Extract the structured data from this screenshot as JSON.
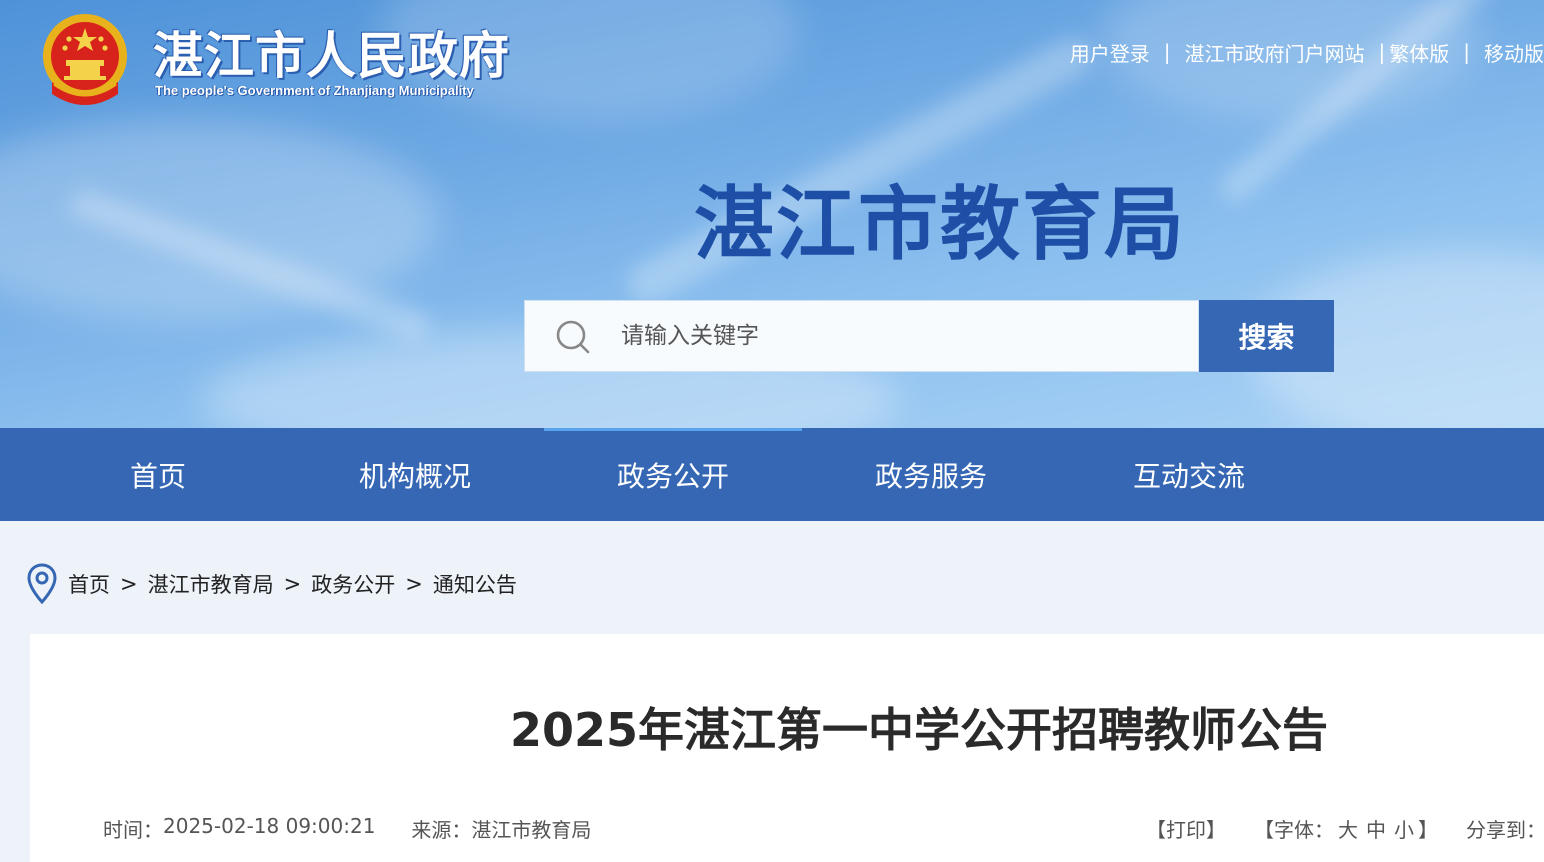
{
  "header": {
    "gov_title": "湛江市人民政府",
    "gov_subtitle": "The people's Government of Zhanjiang Municipality",
    "bureau_title": "湛江市教育局",
    "top_links": {
      "login": "用户登录",
      "portal": "湛江市政府门户网站",
      "traditional": "繁体版",
      "mobile": "移动版",
      "separator": "|"
    }
  },
  "search": {
    "placeholder": "请输入关键字",
    "button_label": "搜索"
  },
  "nav": {
    "items": [
      {
        "label": "首页"
      },
      {
        "label": "机构概况"
      },
      {
        "label": "政务公开"
      },
      {
        "label": "政务服务"
      },
      {
        "label": "互动交流"
      }
    ],
    "active": "政务公开"
  },
  "breadcrumb": {
    "items": [
      "首页",
      "湛江市教育局",
      "政务公开",
      "通知公告"
    ],
    "separator": ">"
  },
  "article": {
    "title": "2025年湛江第一中学公开招聘教师公告",
    "time_label": "时间：",
    "time": "2025-02-18 09:00:21",
    "source_label": "来源：",
    "source": "湛江市教育局",
    "print": "【打印】",
    "font_label": "【字体：",
    "font_large": "大",
    "font_medium": "中",
    "font_small": "小",
    "font_close": "】",
    "share": "分享到："
  },
  "colors": {
    "primary": "#3567b4",
    "bureau_title": "#1d4fa6",
    "page_bg": "#eef3fa"
  },
  "icons": [
    "national-emblem-icon",
    "search-icon",
    "location-pin-icon"
  ]
}
